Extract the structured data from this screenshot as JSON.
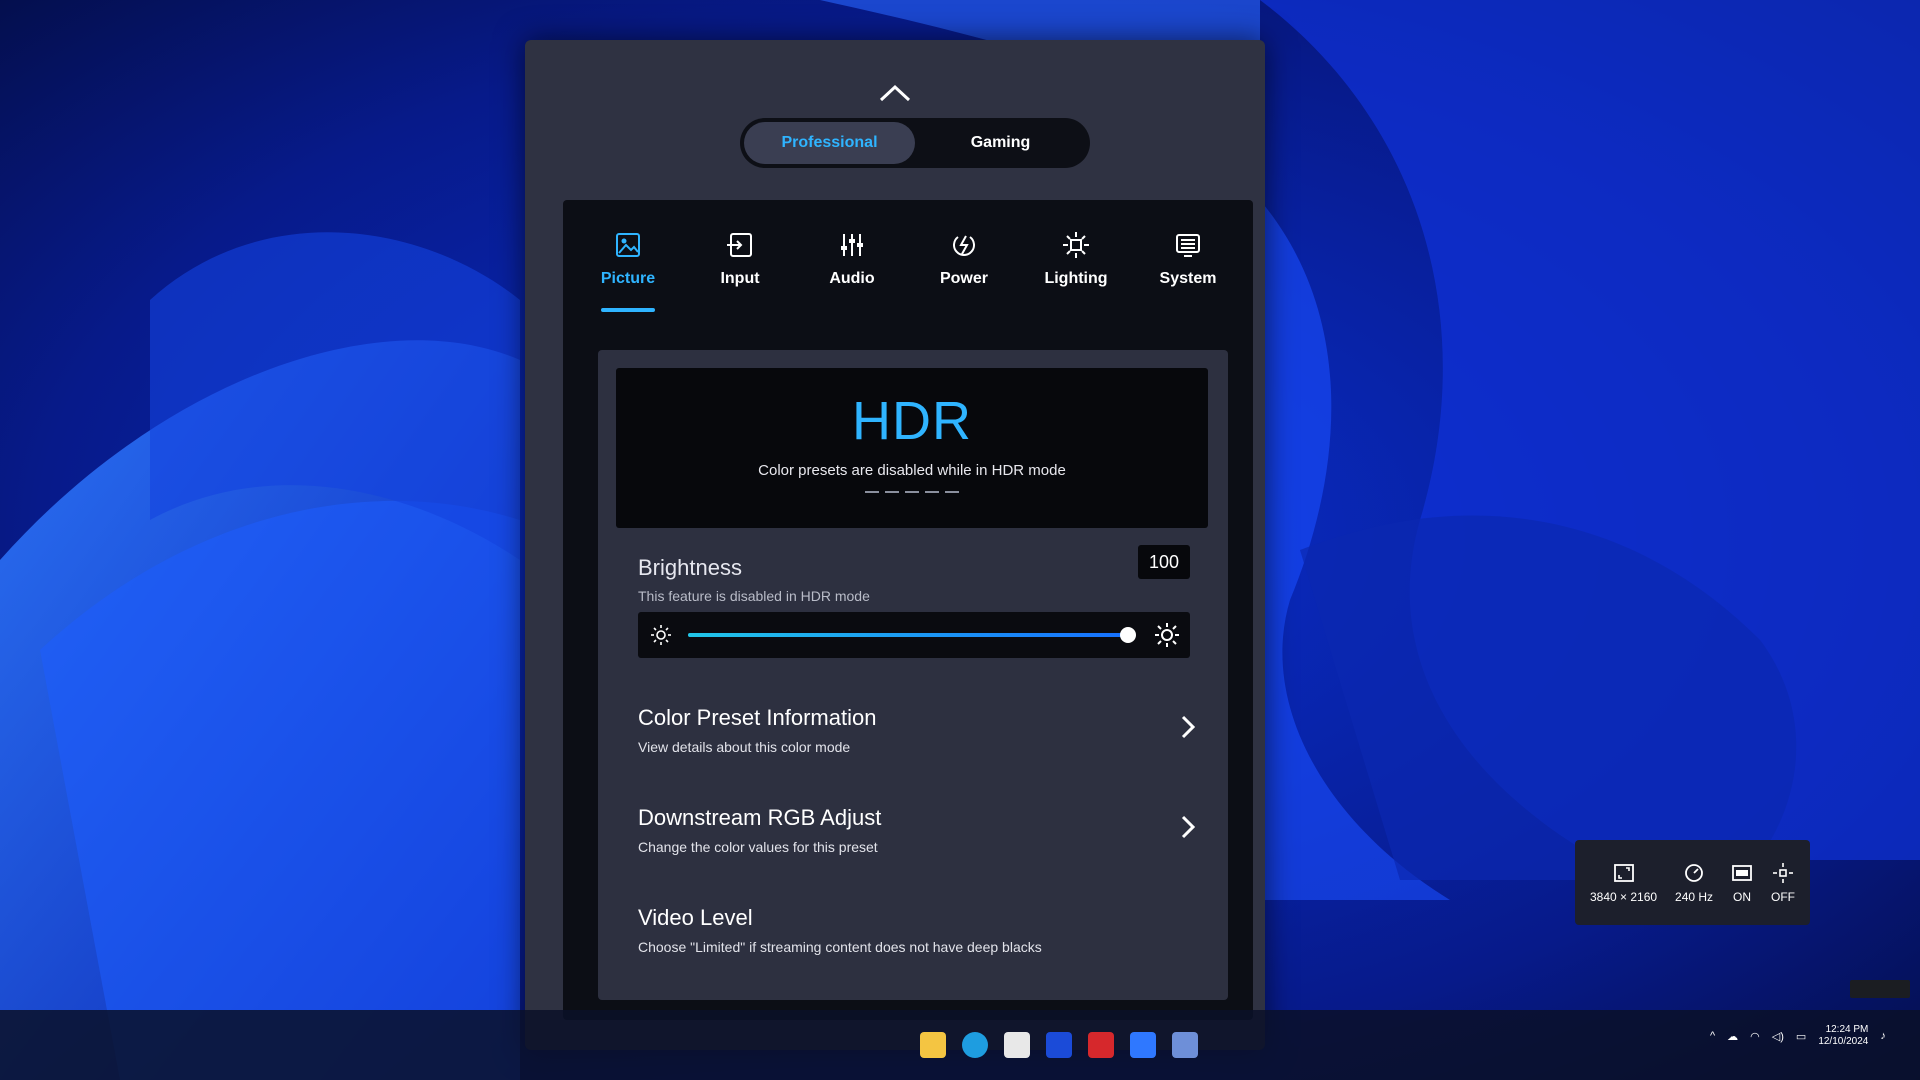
{
  "osd": {
    "modes": [
      {
        "label": "Professional",
        "active": true
      },
      {
        "label": "Gaming",
        "active": false
      }
    ],
    "tabs": [
      {
        "label": "Picture",
        "icon": "picture-icon",
        "active": true
      },
      {
        "label": "Input",
        "icon": "input-icon",
        "active": false
      },
      {
        "label": "Audio",
        "icon": "audio-icon",
        "active": false
      },
      {
        "label": "Power",
        "icon": "power-icon",
        "active": false
      },
      {
        "label": "Lighting",
        "icon": "lighting-icon",
        "active": false
      },
      {
        "label": "System",
        "icon": "system-icon",
        "active": false
      }
    ],
    "hdr": {
      "title": "HDR",
      "subtitle": "Color presets are disabled while in HDR mode"
    },
    "brightness": {
      "title": "Brightness",
      "note": "This feature is disabled in HDR mode",
      "value": "100",
      "level": 1.0
    },
    "menu_items": [
      {
        "title": "Color Preset Information",
        "description": "View details about this color mode",
        "has_chevron": true
      },
      {
        "title": "Downstream RGB Adjust",
        "description": "Change the color values for this preset",
        "has_chevron": true
      },
      {
        "title": "Video Level",
        "description": "Choose \"Limited\" if streaming content does not have deep blacks",
        "has_chevron": false
      }
    ]
  },
  "status": {
    "resolution": "3840 × 2160",
    "refresh": "240 Hz",
    "hdr": "ON",
    "lighting": "OFF"
  },
  "taskbar": {
    "time": "12:24 PM",
    "date": "12/10/2024"
  },
  "colors": {
    "accent": "#2fb4ff",
    "panel": "#2f3242",
    "inner": "#0c0e15"
  }
}
